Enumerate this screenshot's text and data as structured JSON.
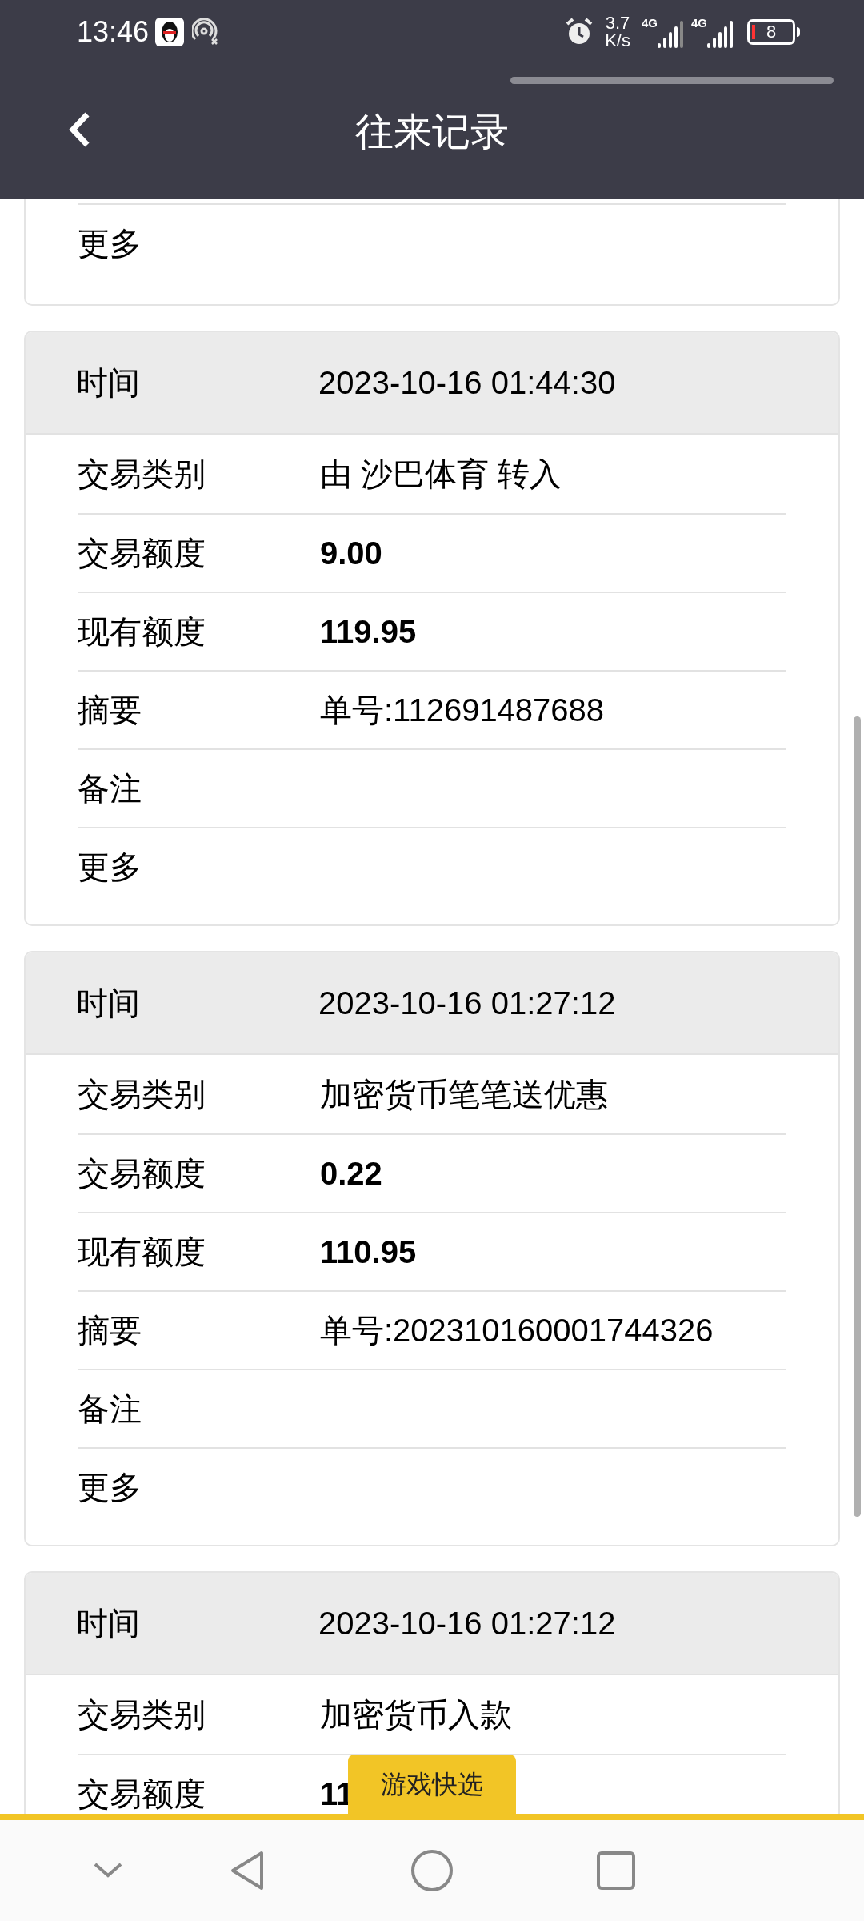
{
  "status_bar": {
    "time": "13:46",
    "speed": [
      "3.7",
      "K/s"
    ],
    "signals": [
      "4G",
      "4G"
    ],
    "battery": "8"
  },
  "header": {
    "title": "往来记录"
  },
  "records": [
    {
      "partial": true,
      "rows": [
        {
          "label": "更多",
          "kind": "text"
        }
      ]
    },
    {
      "partial": false,
      "time_label": "时间",
      "time": "2023-10-16 01:44:30",
      "rows": [
        {
          "label": "交易类别",
          "value": "由 沙巴体育 转入",
          "kind": "text"
        },
        {
          "label": "交易额度",
          "value": "9.00",
          "kind": "amount"
        },
        {
          "label": "现有额度",
          "value": "119.95",
          "kind": "amount"
        },
        {
          "label": "摘要",
          "value": "单号:112691487688",
          "kind": "text"
        },
        {
          "label": "备注",
          "kind": "text"
        },
        {
          "label": "更多",
          "kind": "text"
        }
      ]
    },
    {
      "partial": false,
      "time_label": "时间",
      "time": "2023-10-16 01:27:12",
      "rows": [
        {
          "label": "交易类别",
          "value": "加密货币笔笔送优惠",
          "kind": "text"
        },
        {
          "label": "交易额度",
          "value": "0.22",
          "kind": "amount"
        },
        {
          "label": "现有额度",
          "value": "110.95",
          "kind": "amount"
        },
        {
          "label": "摘要",
          "value": "单号:202310160001744326",
          "kind": "text"
        },
        {
          "label": "备注",
          "kind": "text"
        },
        {
          "label": "更多",
          "kind": "text"
        }
      ]
    },
    {
      "partial": false,
      "time_label": "时间",
      "time": "2023-10-16 01:27:12",
      "rows": [
        {
          "label": "交易类别",
          "value": "加密货币入款",
          "kind": "text"
        },
        {
          "label": "交易额度",
          "value": "11",
          "kind": "amount"
        }
      ]
    }
  ],
  "quick_tab": "游戏快选"
}
